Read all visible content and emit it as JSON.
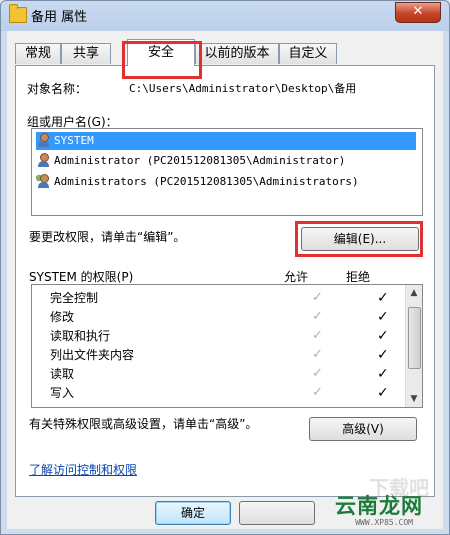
{
  "window": {
    "title": "备用 属性",
    "close_label": "✕"
  },
  "tabs": [
    {
      "label": "常规"
    },
    {
      "label": "共享"
    },
    {
      "label": "安全"
    },
    {
      "label": "以前的版本"
    },
    {
      "label": "自定义"
    }
  ],
  "object": {
    "label": "对象名称：",
    "value": "C:\\Users\\Administrator\\Desktop\\备用"
  },
  "groups": {
    "label": "组或用户名(G)：",
    "items": [
      {
        "name": "SYSTEM"
      },
      {
        "name": "Administrator (PC201512081305\\Administrator)"
      },
      {
        "name": "Administrators (PC201512081305\\Administrators)"
      }
    ]
  },
  "change": {
    "text": "要更改权限，请单击“编辑”。",
    "edit_button": "编辑(E)..."
  },
  "permissions": {
    "title": "SYSTEM 的权限(P)",
    "allow_header": "允许",
    "deny_header": "拒绝",
    "rows": [
      {
        "name": "完全控制",
        "allow": "✓",
        "deny": "✓"
      },
      {
        "name": "修改",
        "allow": "✓",
        "deny": "✓"
      },
      {
        "name": "读取和执行",
        "allow": "✓",
        "deny": "✓"
      },
      {
        "name": "列出文件夹内容",
        "allow": "✓",
        "deny": "✓"
      },
      {
        "name": "读取",
        "allow": "✓",
        "deny": "✓"
      },
      {
        "name": "写入",
        "allow": "✓",
        "deny": "✓"
      }
    ]
  },
  "special": {
    "text": "有关特殊权限或高级设置，请单击“高级”。",
    "advanced_button": "高级(V)"
  },
  "link": {
    "text": "了解访问控制和权限"
  },
  "footer": {
    "ok_button": "确定"
  },
  "watermark": {
    "brand": "云南龙网",
    "url": "WWW.XP85.COM",
    "ghost": "下载吧"
  }
}
